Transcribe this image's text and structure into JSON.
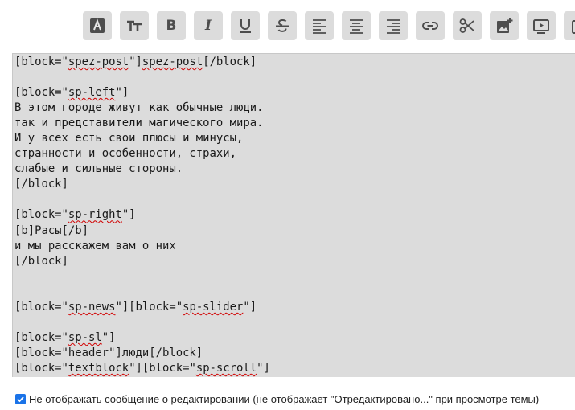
{
  "toolbar": {
    "buttons": [
      {
        "id": "font-color",
        "icon": "font-color-icon"
      },
      {
        "id": "font-size",
        "icon": "font-size-icon"
      },
      {
        "id": "bold",
        "icon": "bold-icon",
        "label": "B"
      },
      {
        "id": "italic",
        "icon": "italic-icon",
        "label": "I"
      },
      {
        "id": "underline",
        "icon": "underline-icon",
        "label": "U"
      },
      {
        "id": "strikethrough",
        "icon": "strikethrough-icon",
        "label": "S"
      },
      {
        "id": "align-left",
        "icon": "align-left-icon"
      },
      {
        "id": "align-center",
        "icon": "align-center-icon"
      },
      {
        "id": "align-right",
        "icon": "align-right-icon"
      },
      {
        "id": "link",
        "icon": "link-icon"
      },
      {
        "id": "cut",
        "icon": "scissors-icon"
      },
      {
        "id": "insert-image",
        "icon": "add-image-icon"
      },
      {
        "id": "insert-video",
        "icon": "video-icon"
      },
      {
        "id": "more",
        "icon": "clipboard-icon"
      }
    ]
  },
  "editor": {
    "lines": [
      "[block=\"spez-post\"]spez-post[/block]",
      "",
      "[block=\"sp-left\"]",
      "В этом городе живут как обычные люди.",
      "так и представители магического мира.",
      "И у всех есть свои плюсы и минусы,",
      "странности и особенности, страхи,",
      "слабые и сильные стороны.",
      "[/block]",
      "",
      "[block=\"sp-right\"]",
      "[b]Расы[/b]",
      "и мы расскажем вам о них",
      "[/block]",
      "",
      "",
      "[block=\"sp-news\"][block=\"sp-slider\"]",
      "",
      "[block=\"sp-sl\"]",
      "[block=\"header\"]люди[/block]",
      "[block=\"textblock\"][block=\"sp-scroll\"]"
    ],
    "misspelled_words": [
      "spez-post",
      "sp-left",
      "sp-right",
      "sp-news",
      "sp-slider",
      "sp-sl",
      "textblock",
      "sp-scroll"
    ]
  },
  "footer": {
    "checkbox_checked": true,
    "checkbox_label": "Не отображать сообщение о редактировании (не отображает \"Отредактировано...\" при просмотре темы)",
    "accent_color": "#1a73e8"
  }
}
